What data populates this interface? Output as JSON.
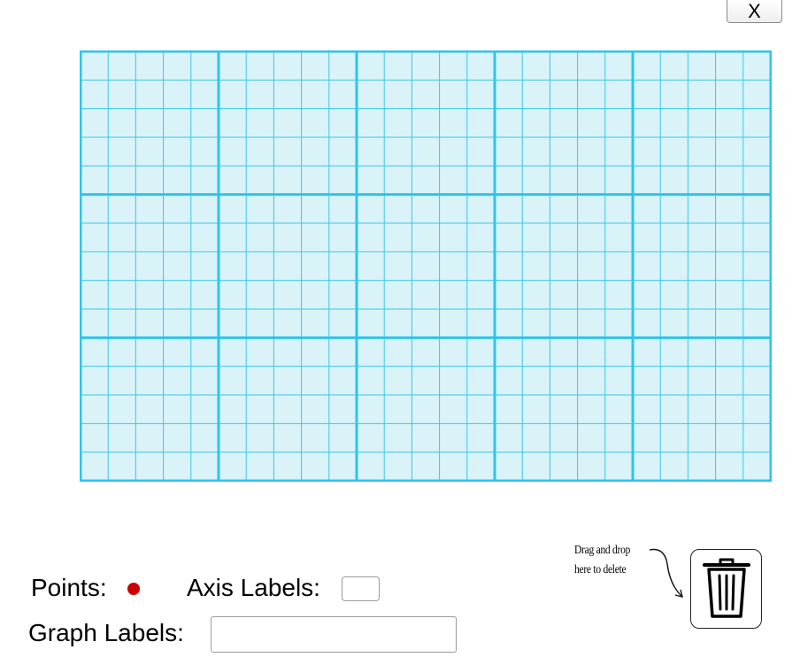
{
  "toolbar": {
    "close_label": "X"
  },
  "graph_paper": {
    "columns": 25,
    "rows": 15,
    "major_every_col": 5,
    "major_every_row": 5,
    "fill_color": "#d9f3f9",
    "minor_line_color": "#3dc6e8",
    "major_line_color": "#2ec4ea"
  },
  "controls": {
    "points_label": "Points:",
    "point_color": "#cc0000",
    "axis_labels_label": "Axis Labels:",
    "graph_labels_label": "Graph Labels:",
    "graph_labels_value": ""
  },
  "trash": {
    "hint_line1": "Drag and drop",
    "hint_line2": "here to delete",
    "icon": "trash-can-icon"
  }
}
